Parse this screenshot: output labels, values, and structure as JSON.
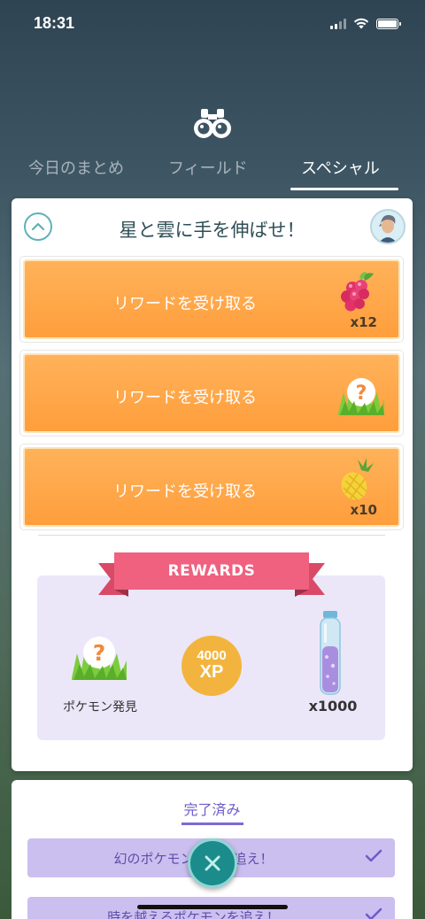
{
  "status_bar": {
    "time": "18:31",
    "icons": [
      "signal-icon",
      "wifi-icon",
      "battery-icon"
    ]
  },
  "tabs": [
    {
      "label": "今日のまとめ",
      "active": false
    },
    {
      "label": "フィールド",
      "active": false
    },
    {
      "label": "スペシャル",
      "active": true
    }
  ],
  "special_quest": {
    "title": "星と雲に手を伸ばせ！",
    "collapse_icon": "chevron-up-icon",
    "avatar_icon": "trainer-avatar-icon",
    "rewards": [
      {
        "label": "リワードを受け取る",
        "item_icon": "razz-berry-icon",
        "quantity": "x12"
      },
      {
        "label": "リワードを受け取る",
        "item_icon": "pokemon-encounter-icon",
        "quantity": ""
      },
      {
        "label": "リワードを受け取る",
        "item_icon": "pinap-berry-icon",
        "quantity": "x10"
      }
    ],
    "final_rewards": {
      "banner": "REWARDS",
      "pokemon_label": "ポケモン発見",
      "xp_amount": "4000",
      "xp_unit": "XP",
      "stardust_quantity": "x1000"
    }
  },
  "completed": {
    "tab_label": "完了済み",
    "quests": [
      {
        "name": "幻のポケモンの姿を追え！"
      },
      {
        "name": "時を越えるポケモンを追え！"
      }
    ]
  },
  "close_button_icon": "close-icon",
  "colors": {
    "accent_teal": "#1c8b8b",
    "reward_orange": "#ff9e3c",
    "ribbon_pink": "#f0607f",
    "xp_gold": "#f3b43f",
    "completed_purple": "#cbbff0"
  }
}
